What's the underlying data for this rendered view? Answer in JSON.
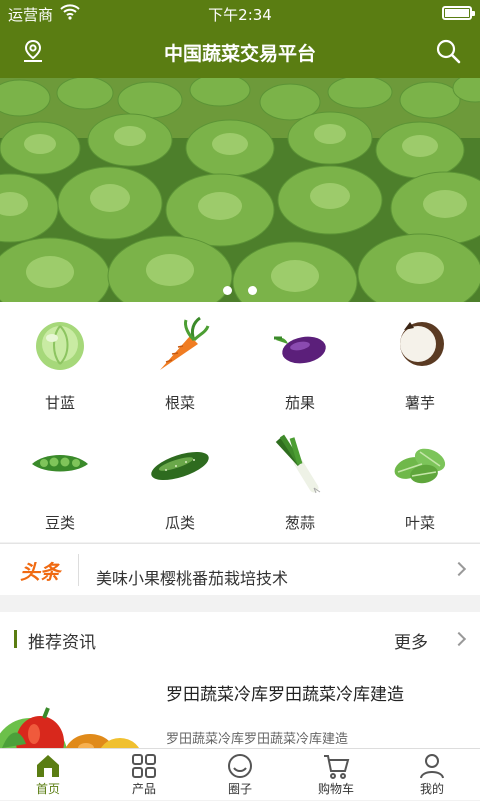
{
  "status": {
    "carrier": "运营商",
    "time": "下午2:34"
  },
  "header": {
    "title": "中国蔬菜交易平台",
    "location_icon": "location-pin-icon",
    "search_icon": "search-icon"
  },
  "colors": {
    "brand": "#5a7d12",
    "headline_tag": "#f06a12"
  },
  "banner": {
    "dots": 2
  },
  "categories": [
    {
      "label": "甘蓝",
      "icon": "cabbage-icon"
    },
    {
      "label": "根菜",
      "icon": "carrot-icon"
    },
    {
      "label": "茄果",
      "icon": "eggplant-icon"
    },
    {
      "label": "薯芋",
      "icon": "taro-icon"
    },
    {
      "label": "豆类",
      "icon": "peas-icon"
    },
    {
      "label": "瓜类",
      "icon": "cucumber-icon"
    },
    {
      "label": "葱蒜",
      "icon": "leek-icon"
    },
    {
      "label": "叶菜",
      "icon": "leafy-greens-icon"
    }
  ],
  "headline": {
    "tag": "头条",
    "text": "美味小果樱桃番茄栽培技术"
  },
  "recommend": {
    "title": "推荐资讯",
    "more": "更多",
    "article": {
      "title": "罗田蔬菜冷库罗田蔬菜冷库建造",
      "desc": "罗田蔬菜冷库罗田蔬菜冷库建造"
    }
  },
  "tabbar": [
    {
      "label": "首页",
      "icon": "home-icon",
      "active": true
    },
    {
      "label": "产品",
      "icon": "grid-icon",
      "active": false
    },
    {
      "label": "圈子",
      "icon": "smile-icon",
      "active": false
    },
    {
      "label": "购物车",
      "icon": "cart-icon",
      "active": false
    },
    {
      "label": "我的",
      "icon": "user-icon",
      "active": false
    }
  ]
}
